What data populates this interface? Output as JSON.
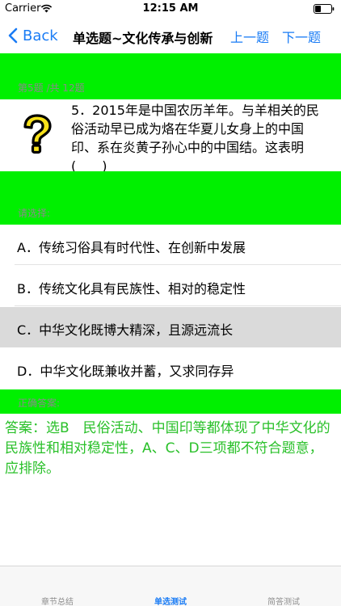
{
  "status": {
    "carrier": "Carrier",
    "time": "12:15 AM"
  },
  "nav": {
    "back_label": "Back",
    "title": "单选题~文化传承与创新",
    "prev_label": "上一题",
    "next_label": "下一题"
  },
  "question": {
    "progress": "第5题 /共 12题",
    "text": "5．2015年是中国农历羊年。与羊相关的民俗活动早已成为烙在华夏儿女身上的中国印、系在炎黄子孙心中的中国结。这表明(　　)"
  },
  "options_header": "请选择:",
  "options": [
    {
      "label": "A．传统习俗具有时代性、在创新中发展"
    },
    {
      "label": "B．传统文化具有民族性、相对的稳定性"
    },
    {
      "label": "C．中华文化既博大精深，且源远流长"
    },
    {
      "label": "D．中华文化既兼收并蓄，又求同存异"
    }
  ],
  "answer_header": "正确答案:",
  "answer": "答案：选B　民俗活动、中国印等都体现了中华文化的民族性和相对稳定性，A、C、D三项都不符合题意，应排除。",
  "tabs": [
    {
      "label": "章节总结"
    },
    {
      "label": "单选测试"
    },
    {
      "label": "简答测试"
    }
  ],
  "colors": {
    "accent": "#1a7cf5",
    "band": "#00f000",
    "answer_text": "#29c029",
    "selected_row": "#dadada"
  }
}
